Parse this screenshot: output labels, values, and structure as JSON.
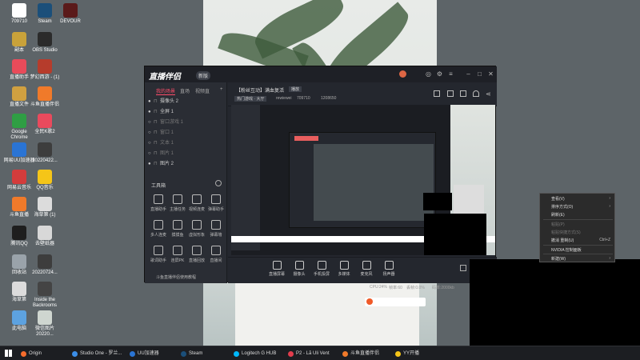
{
  "desktop": {
    "icons": [
      {
        "label": "709710",
        "color": "#ffffff"
      },
      {
        "label": "Steam",
        "color": "#1b4f7a"
      },
      {
        "label": "DEVOUR",
        "color": "#5a1a1a"
      },
      {
        "label": "副本",
        "color": "#c9a23a"
      },
      {
        "label": "OBS Studio",
        "color": "#2b2b2b"
      },
      {
        "label": "直播助手",
        "color": "#e84b5a"
      },
      {
        "label": "梦幻西游 - (1)",
        "color": "#b63c2c"
      },
      {
        "label": "直播文件",
        "color": "#d0a040"
      },
      {
        "label": "斗鱼直播伴侣",
        "color": "#f07a2a"
      },
      {
        "label": "Google Chrome",
        "color": "#2f9e44"
      },
      {
        "label": "全民K歌2",
        "color": "#e94a5d"
      },
      {
        "label": "网易UU加速器",
        "color": "#2a74d4"
      },
      {
        "label": "20220422...",
        "color": "#3d3d3d"
      },
      {
        "label": "网易云音乐",
        "color": "#d43c3c"
      },
      {
        "label": "QQ音乐",
        "color": "#f5c518"
      },
      {
        "label": "斗鱼直播",
        "color": "#f07a2a"
      },
      {
        "label": "海草第 (1)",
        "color": "#dcdcdc"
      },
      {
        "label": "腾讯QQ",
        "color": "#1e1e1e"
      },
      {
        "label": "去壁纸器",
        "color": "#d8d8d8"
      },
      {
        "label": "回收站",
        "color": "#9aa3aa"
      },
      {
        "label": "20220724...",
        "color": "#3d3d3d"
      },
      {
        "label": "海草第",
        "color": "#dcdcdc"
      },
      {
        "label": "Inside the Backrooms",
        "color": "#444444"
      },
      {
        "label": "此电脑",
        "color": "#5da2e0"
      },
      {
        "label": "微信图片 20220...",
        "color": "#cfd6d0"
      }
    ]
  },
  "app": {
    "logo": "直播伴侣",
    "version": "新版",
    "tabs": [
      "我的场景",
      "直场",
      "视频直"
    ],
    "scenes": [
      {
        "label": "摄像头 2",
        "visible": true
      },
      {
        "label": "全屏 1",
        "visible": true
      },
      {
        "label": "窗口游戏 1",
        "visible": false
      },
      {
        "label": "窗口 1",
        "visible": false
      },
      {
        "label": "文本 1",
        "visible": false
      },
      {
        "label": "图片 1",
        "visible": false
      },
      {
        "label": "图片 2",
        "visible": true
      }
    ],
    "toolbox_title": "工具箱",
    "tools": [
      "直播助手",
      "主播任务",
      "视频连麦",
      "弹幕助手",
      "多人连麦",
      "摸摸鱼",
      "虚拟形象",
      "弹幕墙",
      "歌词助手",
      "连屏PK",
      "直播回放",
      "直播间"
    ],
    "live_tip": "斗鱼直播伴侣使用教程",
    "header": {
      "title": "【粉丝互动】满血复活",
      "tag": "播放",
      "category": "热门游戏 · 大厅",
      "room_label": "rewiewei",
      "room_id": "709710",
      "fans": "1208650"
    },
    "bottom_buttons": [
      "直播屏幕",
      "摄像头",
      "手机投屏",
      "多媒体",
      "麦克风",
      "扬声器"
    ],
    "status": [
      "CPU:24%",
      "帧率:60",
      "丢帧:0.0%",
      "码率:2000kb"
    ]
  },
  "context_menu": {
    "items": [
      {
        "label": "查看(V)",
        "shortcut": "",
        "arrow": true,
        "disabled": false
      },
      {
        "label": "排序方式(O)",
        "shortcut": "",
        "arrow": true,
        "disabled": false
      },
      {
        "label": "刷新(E)",
        "shortcut": "",
        "arrow": false,
        "disabled": false
      },
      {
        "label": "粘贴(P)",
        "shortcut": "",
        "arrow": false,
        "disabled": true
      },
      {
        "label": "粘贴快捷方式(S)",
        "shortcut": "",
        "arrow": false,
        "disabled": true
      },
      {
        "label": "撤消 重制(U)",
        "shortcut": "Ctrl+Z",
        "arrow": false,
        "disabled": false
      },
      {
        "label": "NVIDIA 控制面板",
        "shortcut": "",
        "arrow": false,
        "disabled": false
      },
      {
        "label": "新建(W)",
        "shortcut": "",
        "arrow": true,
        "disabled": false
      }
    ]
  },
  "taskbar": {
    "items": [
      {
        "label": "Origin",
        "color": "#f56c2d"
      },
      {
        "label": "Studio One - 罗兰...",
        "color": "#3b8ee8"
      },
      {
        "label": "UU加速器",
        "color": "#2a74d4"
      },
      {
        "label": "Steam",
        "color": "#1b4f7a"
      },
      {
        "label": "Logitech G HUB",
        "color": "#00b8fc"
      },
      {
        "label": "P2 - Lã Uli Vent",
        "color": "#e23c4c"
      },
      {
        "label": "斗鱼直播伴侣",
        "color": "#f07a2a"
      },
      {
        "label": "YY开播",
        "color": "#f5c518"
      }
    ]
  }
}
